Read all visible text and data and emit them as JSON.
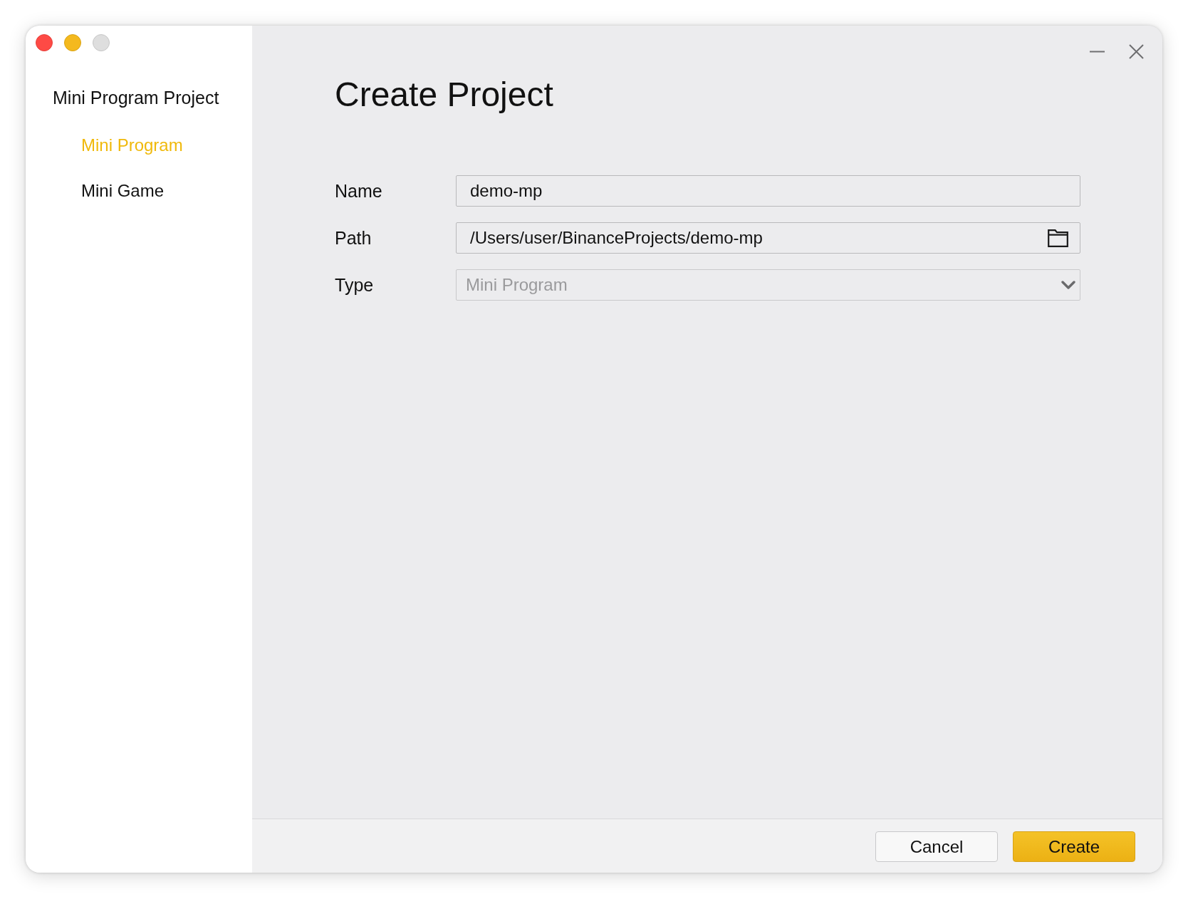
{
  "sidebar": {
    "title": "Mini Program Project",
    "items": [
      {
        "label": "Mini Program",
        "selected": true
      },
      {
        "label": "Mini Game",
        "selected": false
      }
    ]
  },
  "form": {
    "title": "Create Project",
    "fields": [
      {
        "kind": "text",
        "label": "Name",
        "value": "demo-mp",
        "disabled": false
      },
      {
        "kind": "path",
        "label": "Path",
        "value": "/Users/user/BinanceProjects/demo-mp",
        "disabled": false
      },
      {
        "kind": "select",
        "label": "Type",
        "value": "Mini Program",
        "disabled": true
      }
    ]
  },
  "buttons": [
    {
      "kind": "secondary",
      "label": "Cancel"
    },
    {
      "kind": "primary",
      "label": "Create"
    }
  ]
}
